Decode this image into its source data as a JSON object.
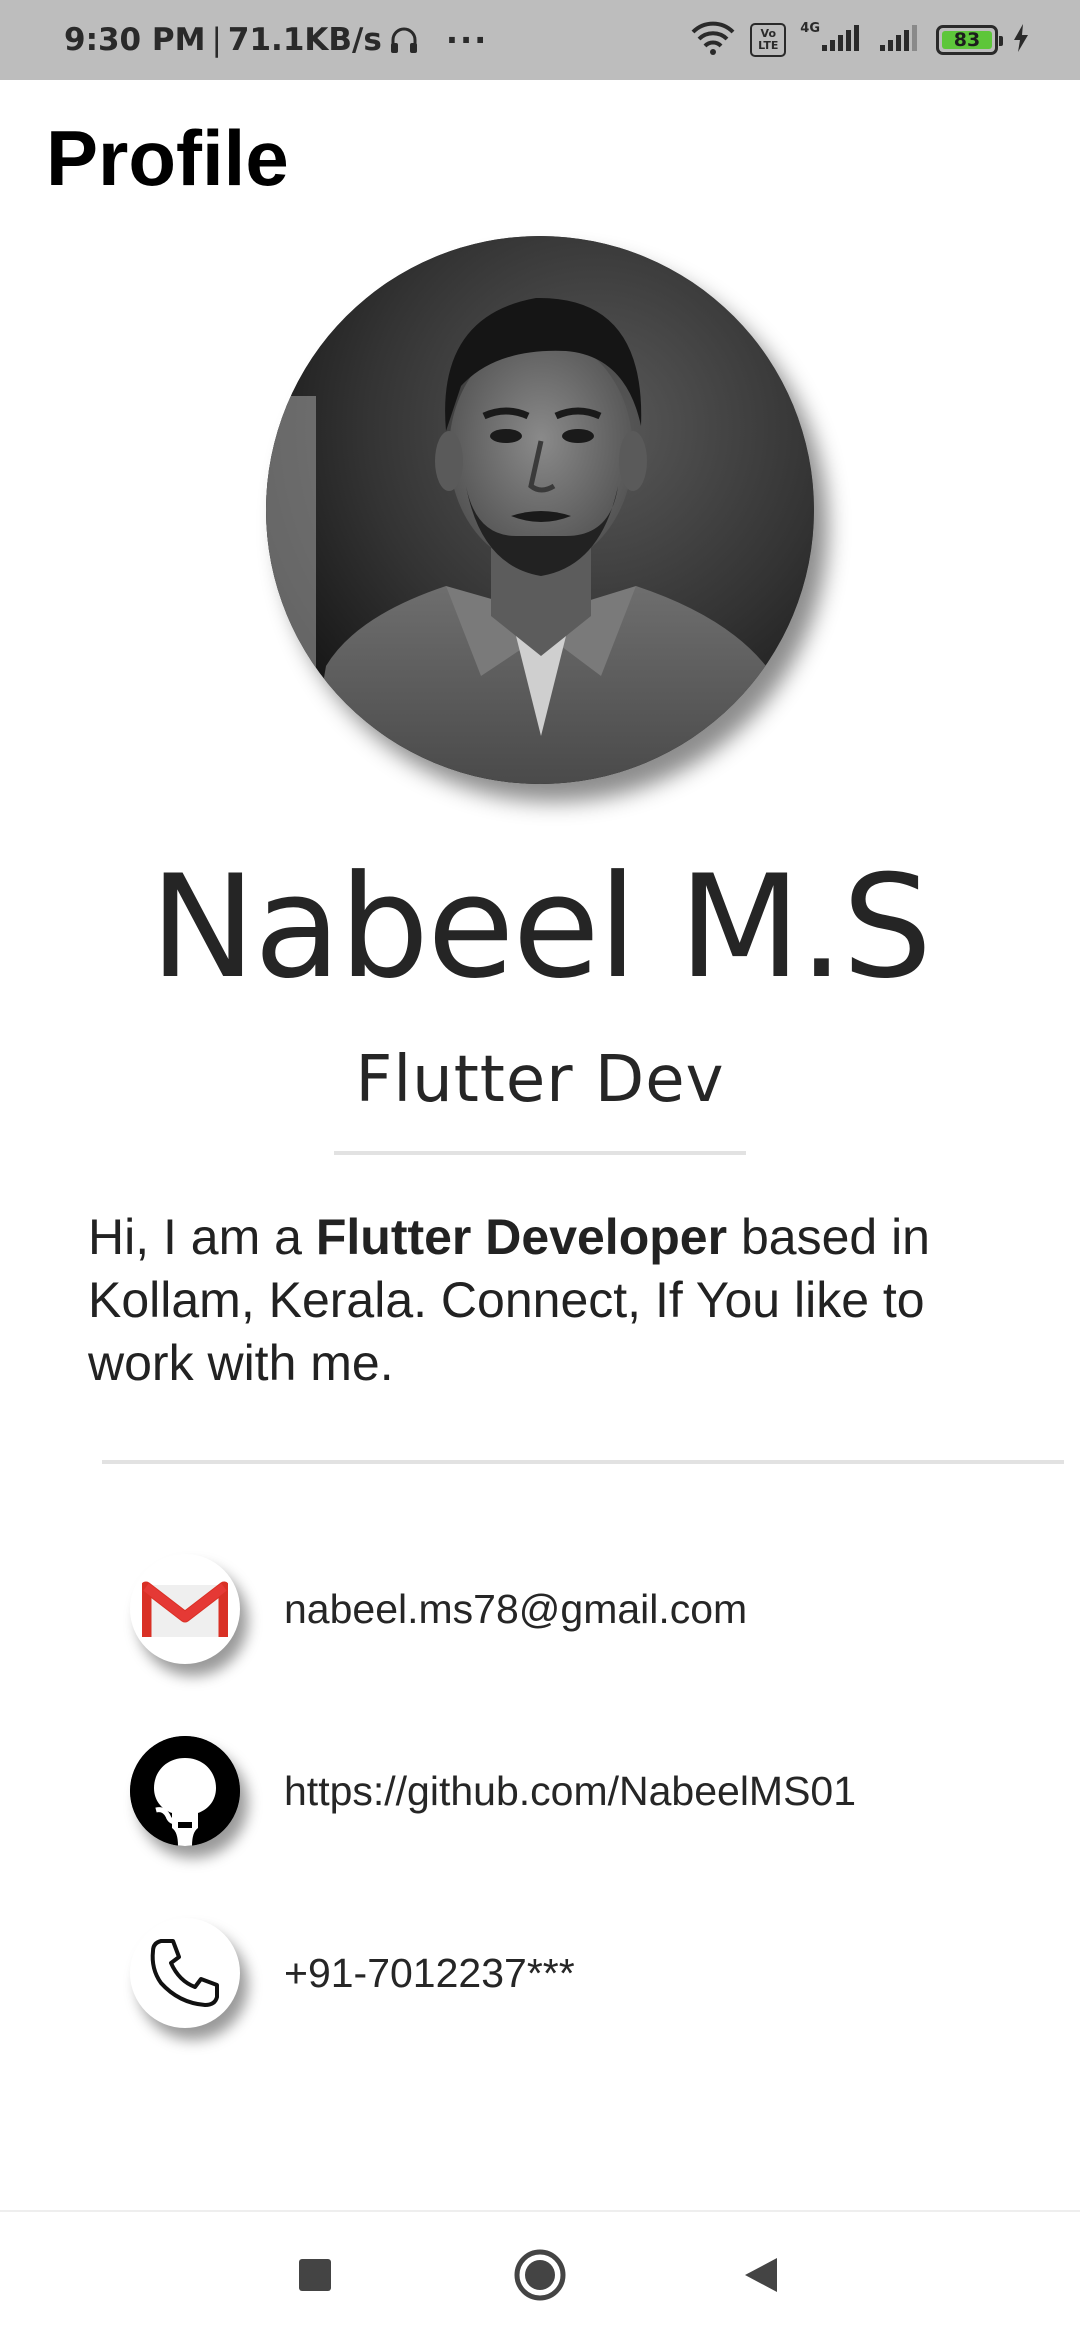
{
  "status_bar": {
    "time": "9:30 PM",
    "net_speed": "71.1KB/s",
    "overflow": "···",
    "volte_top": "Vo",
    "volte_bottom": "LTE",
    "network_type": "4G",
    "battery_level": "83",
    "battery_color": "#5dc63a"
  },
  "page": {
    "title": "Profile"
  },
  "profile": {
    "name": "Nabeel M.S",
    "role": "Flutter Dev",
    "bio_prefix": "Hi, I am a ",
    "bio_bold": "Flutter Developer",
    "bio_suffix": " based in Kollam, Kerala. Connect, If You like to work with me."
  },
  "contacts": {
    "email": "nabeel.ms78@gmail.com",
    "github": "https://github.com/NabeelMS01",
    "phone": "+91-7012237***"
  },
  "icons": {
    "email": "gmail-icon",
    "github": "github-icon",
    "phone": "phone-icon"
  },
  "nav": {
    "recent": "square-icon",
    "home": "circle-icon",
    "back": "triangle-back-icon"
  }
}
